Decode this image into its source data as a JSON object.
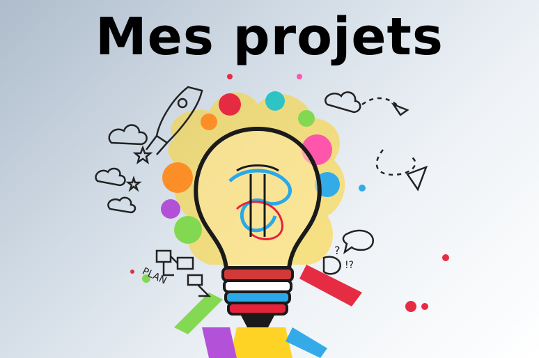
{
  "title": "Mes projets",
  "illustration": {
    "subject": "light-bulb-icon",
    "doodle_label": "PLAN"
  },
  "colors": {
    "title": "#000000",
    "background_left": "#aebccb",
    "background_right": "#ffffff",
    "splash": [
      "#e6223a",
      "#ffd21a",
      "#2aa8e8",
      "#7fd84a",
      "#b04ad8",
      "#ff8a1e",
      "#ff4fa8",
      "#25c2c2"
    ]
  }
}
